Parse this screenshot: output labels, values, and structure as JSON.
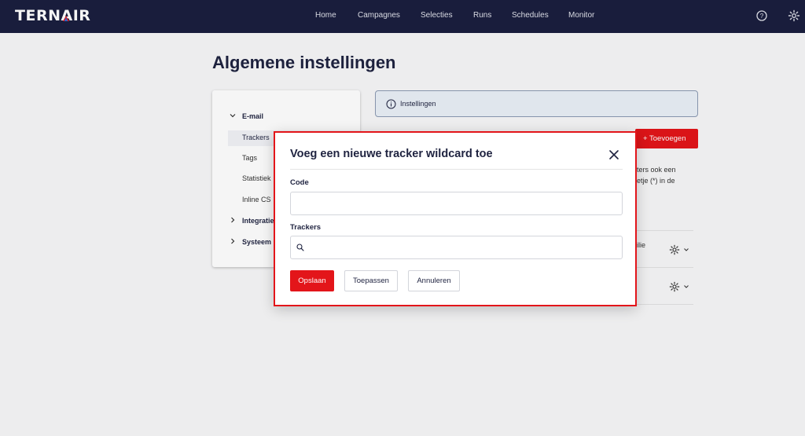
{
  "app": {
    "logo_prefix": "TERN",
    "logo_mark": "A",
    "logo_suffix": "IR",
    "nav": [
      "Home",
      "Campagnes",
      "Selecties",
      "Runs",
      "Schedules",
      "Monitor"
    ],
    "icons": {
      "help": "help-circle-icon",
      "settings": "gear-icon"
    }
  },
  "page": {
    "title": "Algemene instellingen",
    "sidebar": {
      "group_email": "E-mail",
      "items": [
        "Trackers",
        "Tags",
        "Statistiek",
        "Inline CS"
      ],
      "group_integrations": "Integratie",
      "group_system": "Systeem"
    },
    "info_text": "Instellingen",
    "add_button": "+ Toevoegen",
    "bg_text_1": "ters ook een",
    "bg_text_2": "etje (*) in de",
    "bg_text_3": "ilie"
  },
  "modal": {
    "title": "Voeg een nieuwe tracker wildcard toe",
    "code_label": "Code",
    "code_value": "",
    "trackers_label": "Trackers",
    "trackers_value": "",
    "save_label": "Opslaan",
    "apply_label": "Toepassen",
    "cancel_label": "Annuleren"
  },
  "colors": {
    "nav_bg": "#1b1f3f",
    "accent": "#e3151a",
    "heading": "#1f2340"
  }
}
